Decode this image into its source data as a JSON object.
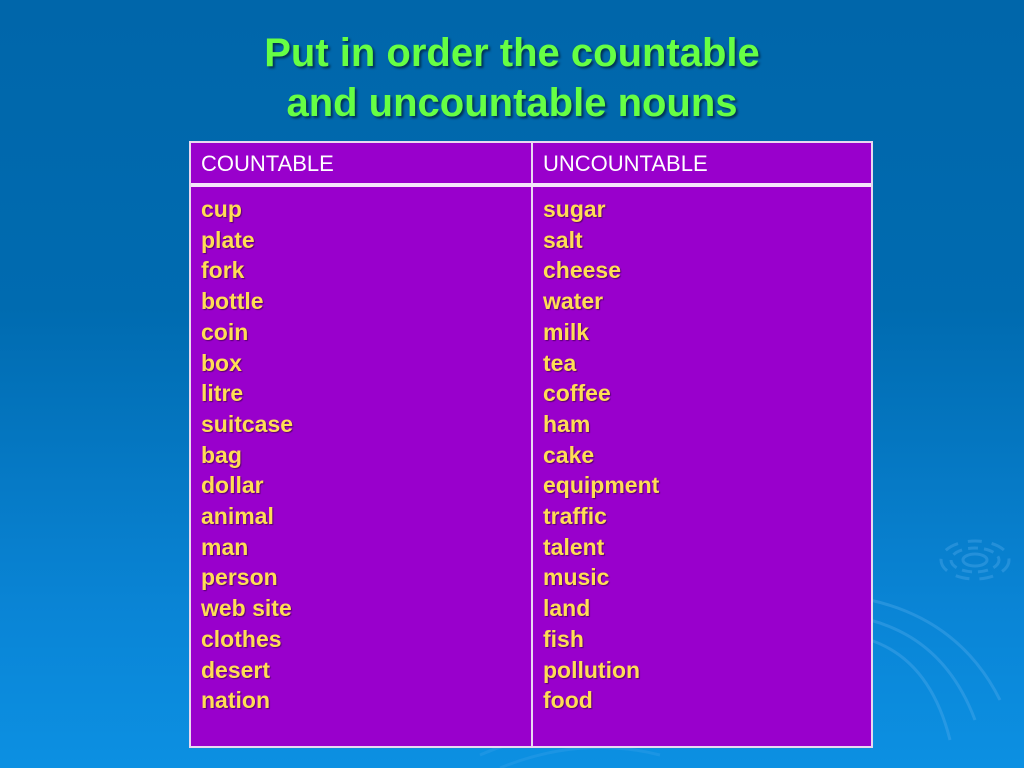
{
  "slide": {
    "title_lines": [
      "Put in order the countable",
      "and uncountable nouns"
    ],
    "colors": {
      "background": "#0066aa",
      "title": "#66ff44",
      "table_fill": "#9900cc",
      "header_text": "#ffffff",
      "word_text": "#ffdd55"
    }
  },
  "table": {
    "headers": [
      "COUNTABLE",
      "UNCOUNTABLE"
    ],
    "countable": [
      "cup",
      "plate",
      "fork",
      "bottle",
      "coin",
      "box",
      "litre",
      "suitcase",
      "bag",
      "dollar",
      "animal",
      "man",
      "person",
      "web site",
      "clothes",
      "desert",
      "nation"
    ],
    "uncountable": [
      "sugar",
      "salt",
      "cheese",
      "water",
      "milk",
      "tea",
      "coffee",
      "ham",
      "cake",
      "equipment",
      "traffic",
      "talent",
      "music",
      "land",
      "fish",
      "pollution",
      "food"
    ]
  }
}
